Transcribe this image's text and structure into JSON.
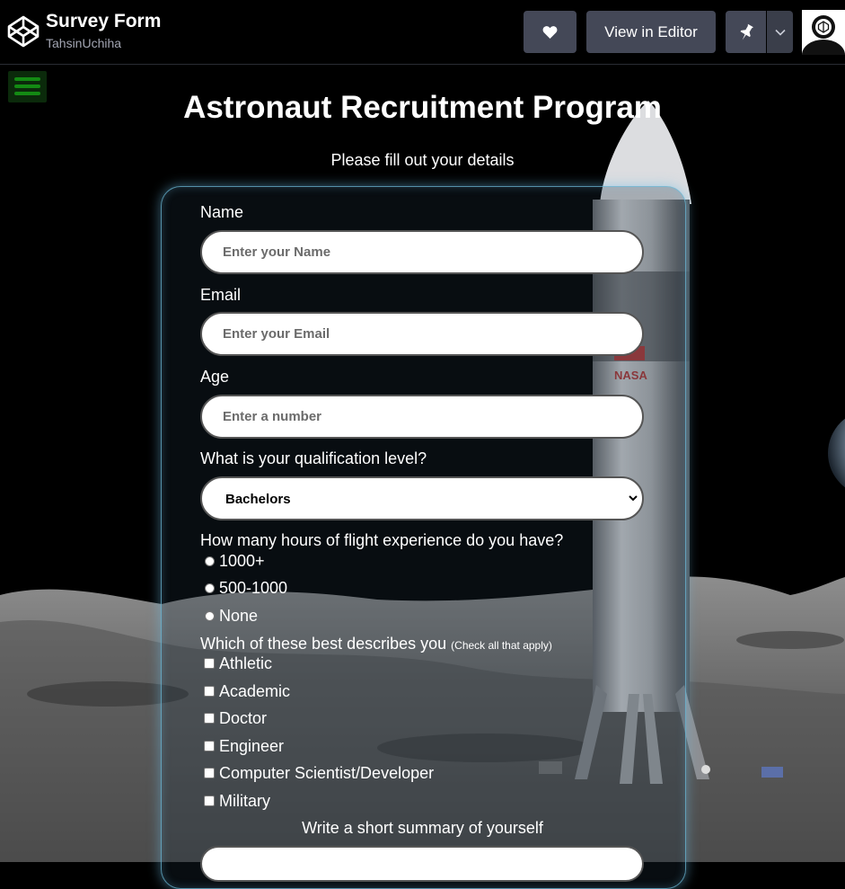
{
  "header": {
    "title": "Survey Form",
    "author": "TahsinUchiha",
    "view_editor_label": "View in Editor",
    "icons": [
      "codepen-logo-icon",
      "heart-icon",
      "pin-icon",
      "chevron-down-icon",
      "avatar"
    ]
  },
  "page": {
    "heading": "Astronaut Recruitment Program",
    "subheading": "Please fill out your details"
  },
  "form": {
    "name_label": "Name",
    "name_placeholder": "Enter your Name",
    "email_label": "Email",
    "email_placeholder": "Enter your Email",
    "age_label": "Age",
    "age_placeholder": "Enter a number",
    "qualification_label": "What is your qualification level?",
    "qualification_value": "Bachelors",
    "flight_label": "How many hours of flight experience do you have?",
    "flight_options": [
      "1000+",
      "500-1000",
      "None"
    ],
    "describe_label": "Which of these best describes you",
    "describe_hint": "(Check all that apply)",
    "describe_options": [
      "Athletic",
      "Academic",
      "Doctor",
      "Engineer",
      "Computer Scientist/Developer",
      "Military"
    ],
    "summary_label": "Write a short summary of yourself"
  },
  "colors": {
    "background": "#000000",
    "header_button": "#444857",
    "menu_accent": "#138a13",
    "card_border": "#6ebedc"
  }
}
